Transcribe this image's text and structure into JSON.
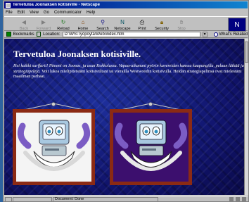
{
  "window": {
    "title": "Tervetuloa Joonaksen kotisiville - Netscape"
  },
  "menu": [
    "File",
    "Edit",
    "View",
    "Go",
    "Communicator",
    "Help"
  ],
  "toolbar": {
    "buttons": [
      {
        "label": "Back",
        "icon": "back-arrow",
        "enabled": false
      },
      {
        "label": "Forward",
        "icon": "forward-arrow",
        "enabled": false
      },
      {
        "label": "Reload",
        "icon": "reload",
        "enabled": true
      },
      {
        "label": "Home",
        "icon": "home",
        "enabled": true
      },
      {
        "label": "Search",
        "icon": "search",
        "enabled": true
      },
      {
        "label": "Netscape",
        "icon": "netscape",
        "enabled": true
      },
      {
        "label": "Print",
        "icon": "print",
        "enabled": true
      },
      {
        "label": "Security",
        "icon": "security-lock",
        "enabled": true
      },
      {
        "label": "Stop",
        "icon": "stop",
        "enabled": false
      }
    ]
  },
  "location": {
    "bookmarks_label": "Bookmarks",
    "location_label": "Location:",
    "url": "D:\\WS\\Työpöytä\\Web\\index.htm",
    "related_label": "What's Related"
  },
  "page": {
    "title": "Tervetuloa Joonaksen kotisiville.",
    "intro_italic": "Hei kaikki surffarit! Nimeni on Joonas, ja asun Kokkolassa. Vapaa-aikanani pyörin kavereiden kanssa kaupungilla, pelaan lätkää ja strategiapelejä.",
    "intro_rest": " Voit lukea mielipiteistäni kotisivultani tai vierailla Westwoodin kotisivulla. Heidän strategiapelinsä ovat mielestäni maailman parhaat."
  },
  "status": {
    "text": "Document: Done"
  },
  "colors": {
    "title_bar": "#000080",
    "page_background": "#10136a",
    "frame_wood": "#8b2a14",
    "monitor_body": "#a8c8e0",
    "horn": "#7b5cc4"
  }
}
